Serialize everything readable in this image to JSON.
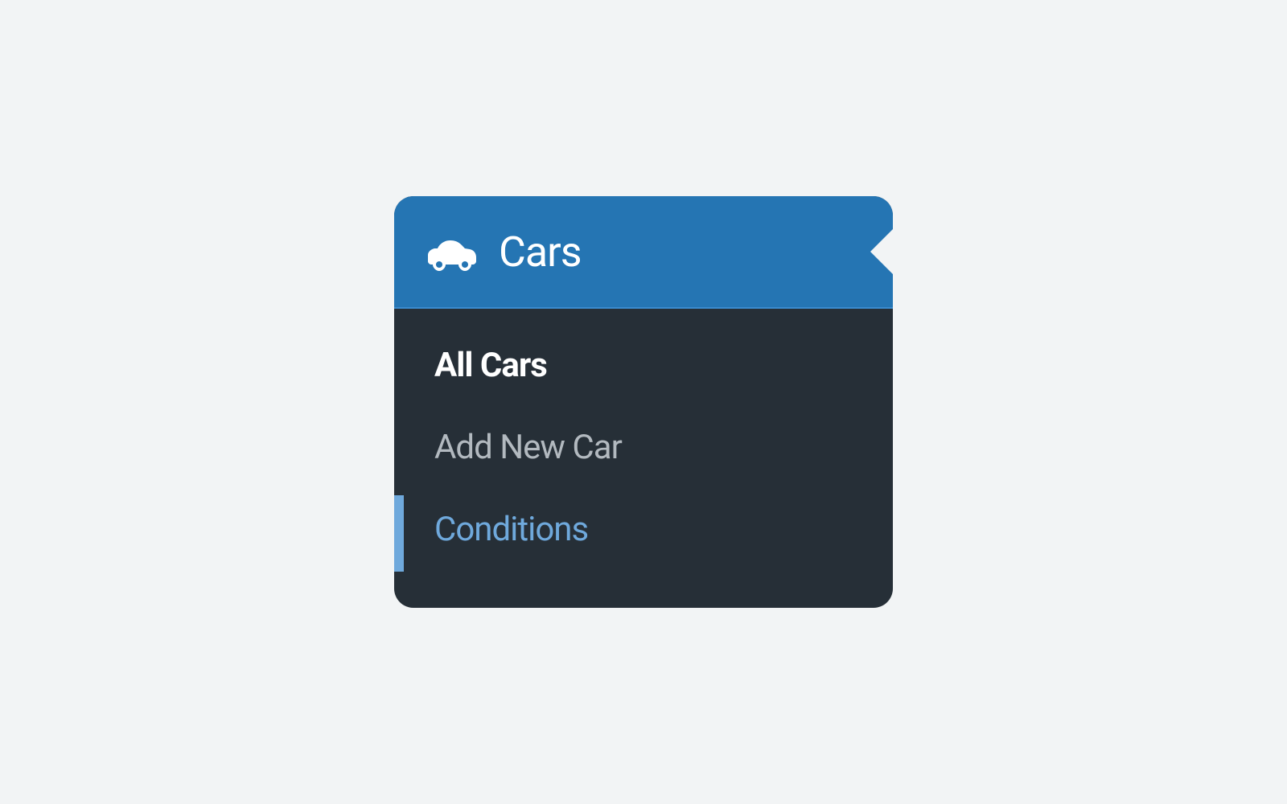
{
  "sidebar": {
    "header": {
      "title": "Cars",
      "icon_name": "car-icon"
    },
    "items": [
      {
        "label": "All Cars",
        "state": "current"
      },
      {
        "label": "Add New Car",
        "state": "normal"
      },
      {
        "label": "Conditions",
        "state": "highlighted"
      }
    ]
  }
}
